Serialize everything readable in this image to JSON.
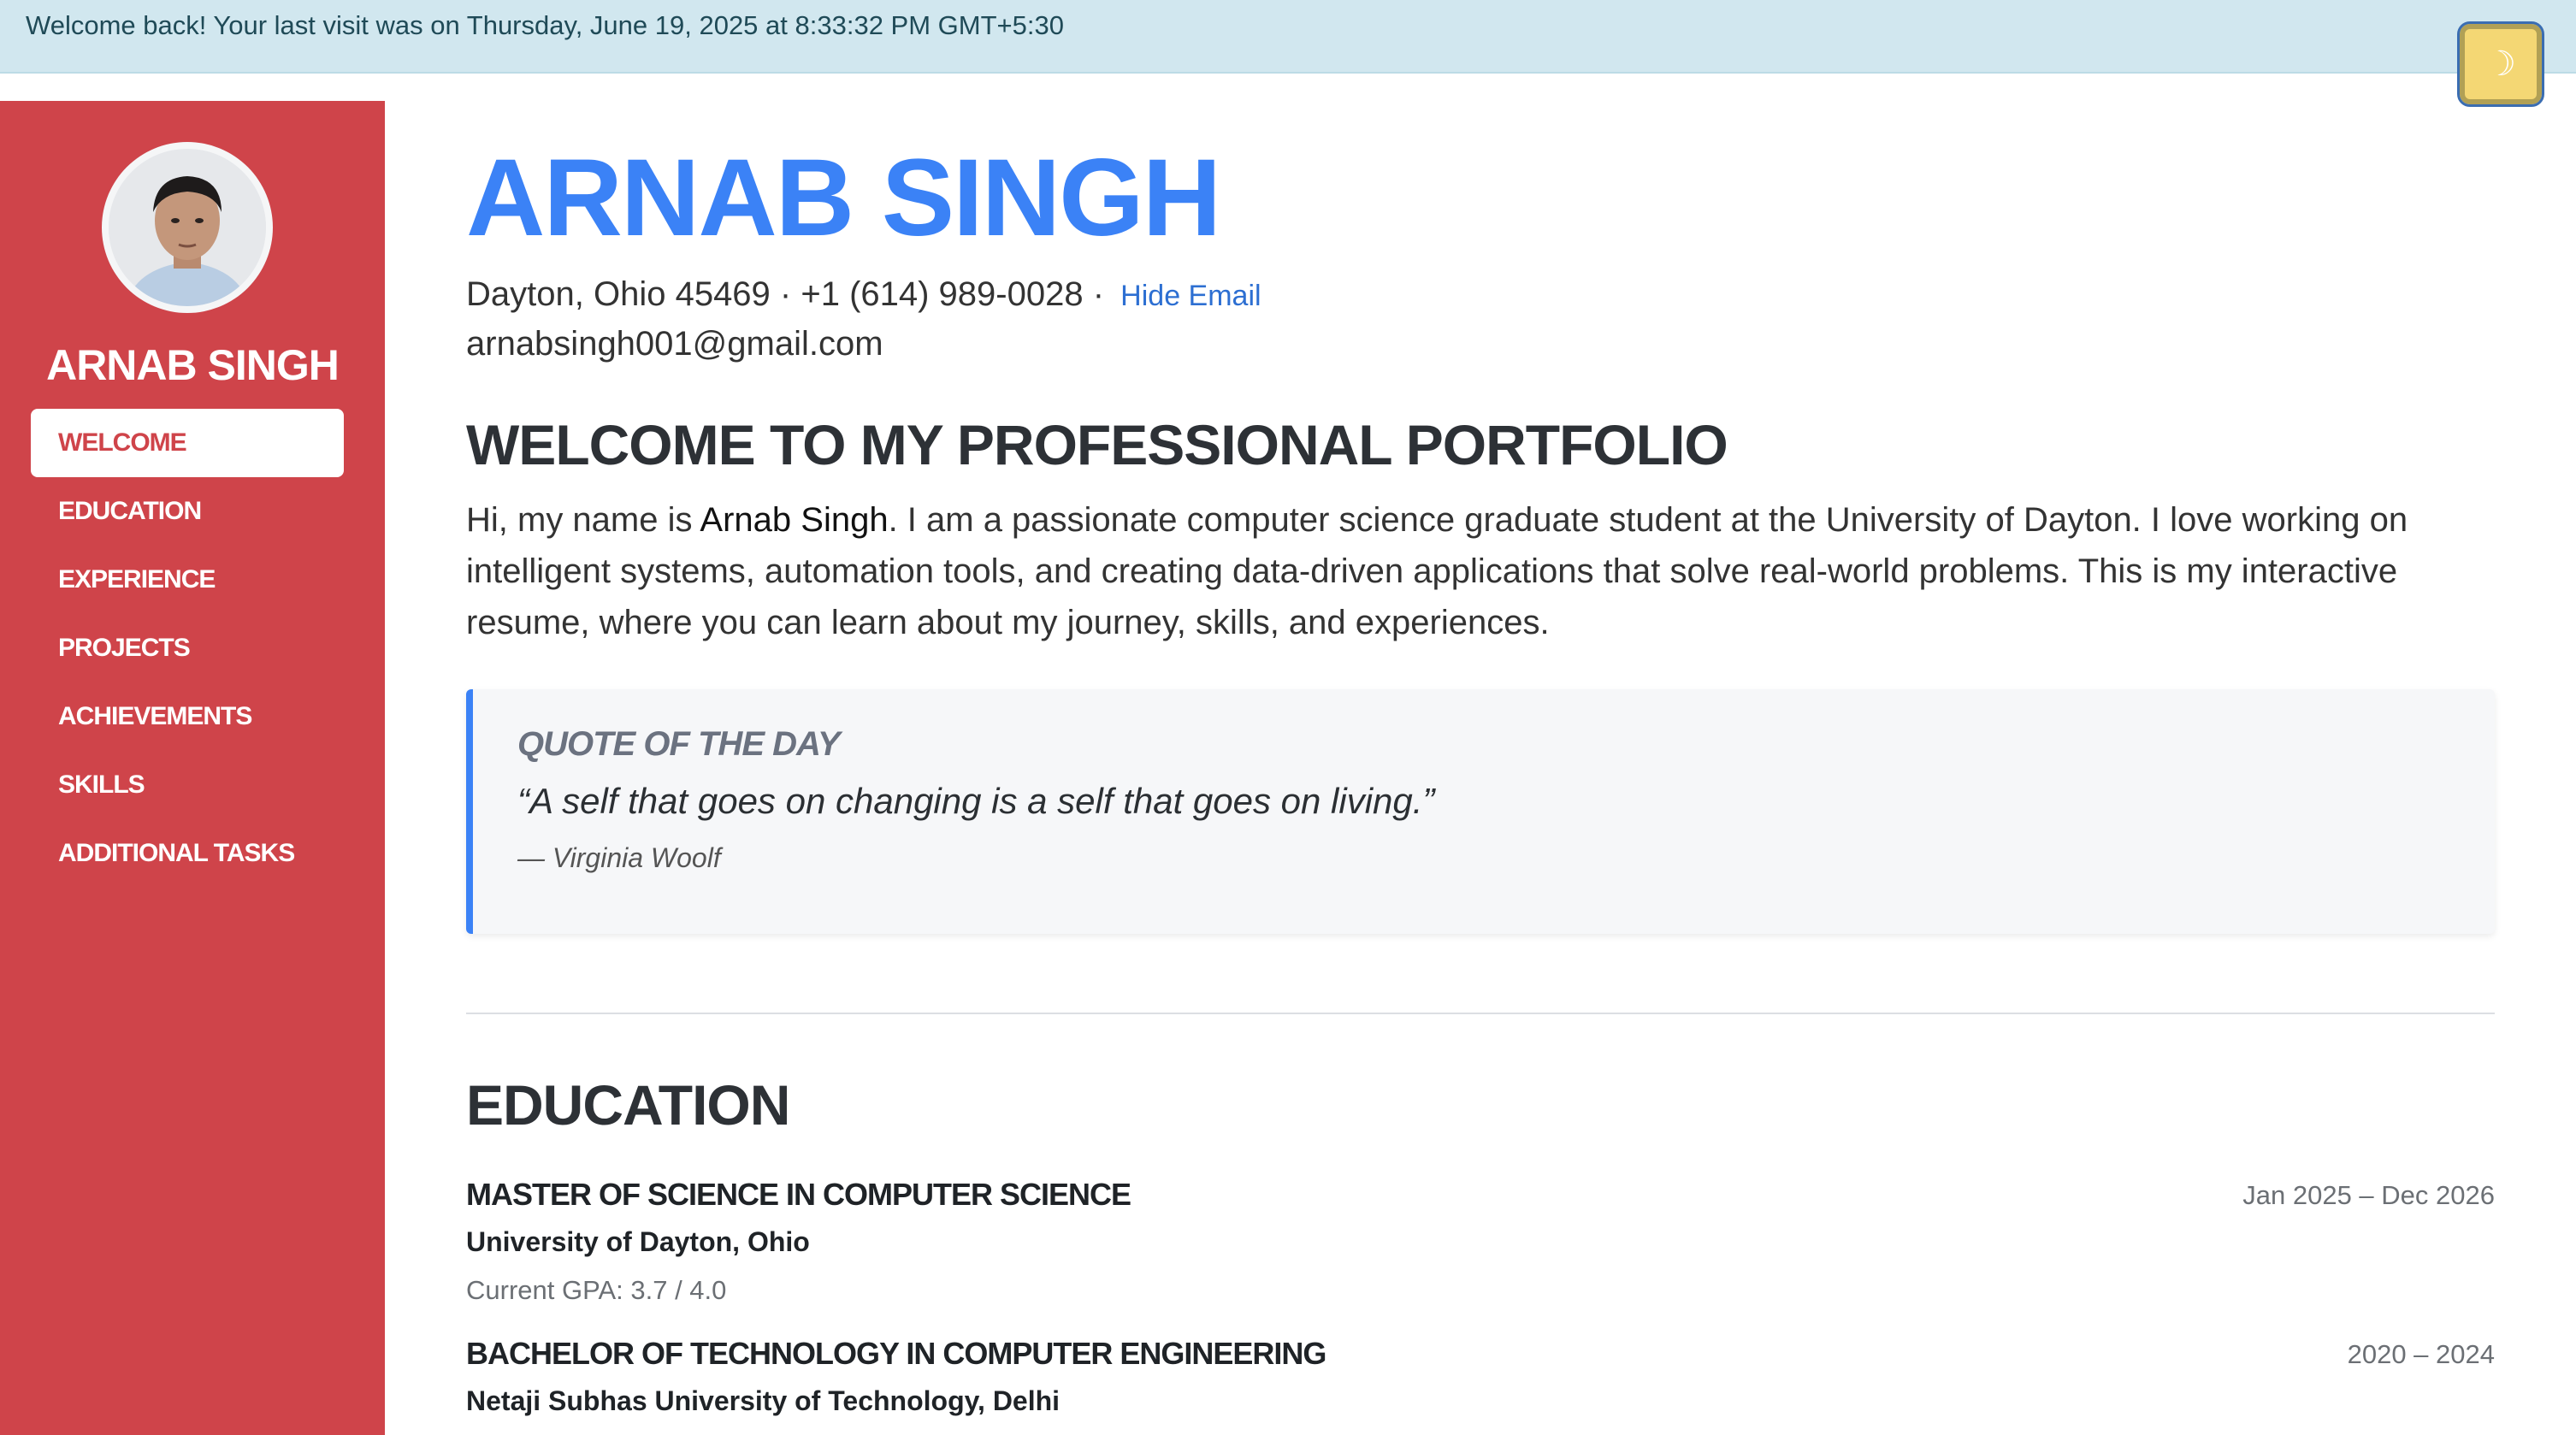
{
  "banner": {
    "text": "Welcome back! Your last visit was on Thursday, June 19, 2025 at 8:33:32 PM GMT+5:30",
    "theme_toggle_icon": "moon-icon",
    "theme_toggle_glyph": "☽"
  },
  "sidebar": {
    "name": "ARNAB SINGH",
    "avatar_alt": "profile photo",
    "items": [
      {
        "label": "WELCOME",
        "active": true
      },
      {
        "label": "EDUCATION",
        "active": false
      },
      {
        "label": "EXPERIENCE",
        "active": false
      },
      {
        "label": "PROJECTS",
        "active": false
      },
      {
        "label": "ACHIEVEMENTS",
        "active": false
      },
      {
        "label": "SKILLS",
        "active": false
      },
      {
        "label": "ADDITIONAL TASKS",
        "active": false
      }
    ]
  },
  "header": {
    "name": "ARNAB SINGH",
    "location_phone": "Dayton, Ohio 45469 · +1 (614) 989-0028 ·",
    "hide_email_label": "Hide Email",
    "email": "arnabsingh001@gmail.com"
  },
  "welcome": {
    "heading": "WELCOME TO MY PROFESSIONAL PORTFOLIO",
    "intro_before": "Hi, my name is ",
    "intro_name": "Arnab Singh",
    "intro_after": ". I am a passionate computer science graduate student at the University of Dayton. I love working on intelligent systems, automation tools, and creating data-driven applications that solve real-world problems. This is my interactive resume, where you can learn about my journey, skills, and experiences."
  },
  "quote": {
    "label": "QUOTE OF THE DAY",
    "text": "“A self that goes on changing is a self that goes on living.”",
    "author": "— Virginia Woolf"
  },
  "education": {
    "heading": "EDUCATION",
    "entries": [
      {
        "degree": "MASTER OF SCIENCE IN COMPUTER SCIENCE",
        "school": "University of Dayton, Ohio",
        "gpa": "Current GPA: 3.7 / 4.0",
        "dates": "Jan 2025 – Dec 2026"
      },
      {
        "degree": "BACHELOR OF TECHNOLOGY IN COMPUTER ENGINEERING",
        "school": "Netaji Subhas University of Technology, Delhi",
        "dates": "2020 – 2024"
      }
    ]
  },
  "colors": {
    "sidebar": "#cf444a",
    "accent_blue": "#3b82f6",
    "banner": "#d1e7ef"
  }
}
